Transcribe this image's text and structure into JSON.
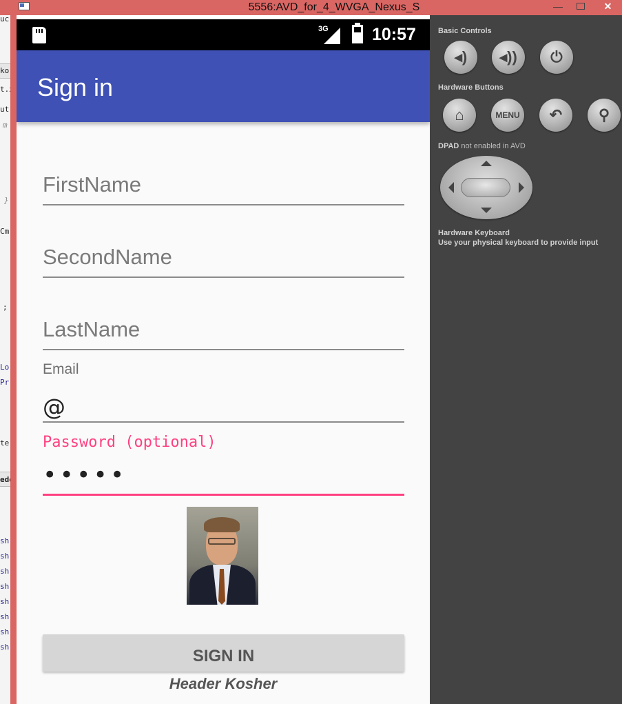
{
  "window": {
    "title": "5556:AVD_for_4_WVGA_Nexus_S",
    "minimize_label": "—",
    "close_label": "✕"
  },
  "ide_strip": {
    "fragments": [
      "uc",
      "ko",
      "t.x",
      "ut",
      "m",
      "}",
      "Cm",
      ";",
      "Lo",
      "Pr",
      "te",
      "ede",
      "sh",
      "sh",
      "sh",
      "sh",
      "sh",
      "sh",
      "sh",
      "sh"
    ]
  },
  "statusbar": {
    "network": "3G",
    "time": "10:57"
  },
  "appbar": {
    "title": "Sign in"
  },
  "form": {
    "first_name_hint": "FirstName",
    "second_name_hint": "SecondName",
    "last_name_hint": "LastName",
    "email_label": "Email",
    "email_value": "@",
    "password_label": "Password (optional)",
    "password_value": "•••••",
    "signin_label": "SIGN IN",
    "footer_text": "Header Kosher"
  },
  "controls": {
    "basic_title": "Basic Controls",
    "hardware_title": "Hardware Buttons",
    "menu_label": "MENU",
    "dpad_title": "DPAD",
    "dpad_note": "not enabled in AVD",
    "keyboard_title": "Hardware Keyboard",
    "keyboard_note": "Use your physical keyboard to provide input"
  },
  "colors": {
    "accent": "#ff4081",
    "primary": "#3f51b5",
    "titlebar": "#d96663",
    "panel": "#434343"
  },
  "icons": [
    "sd-card-icon",
    "signal-icon",
    "battery-icon",
    "volume-down-icon",
    "volume-up-icon",
    "power-icon",
    "home-icon",
    "back-icon",
    "search-icon"
  ]
}
